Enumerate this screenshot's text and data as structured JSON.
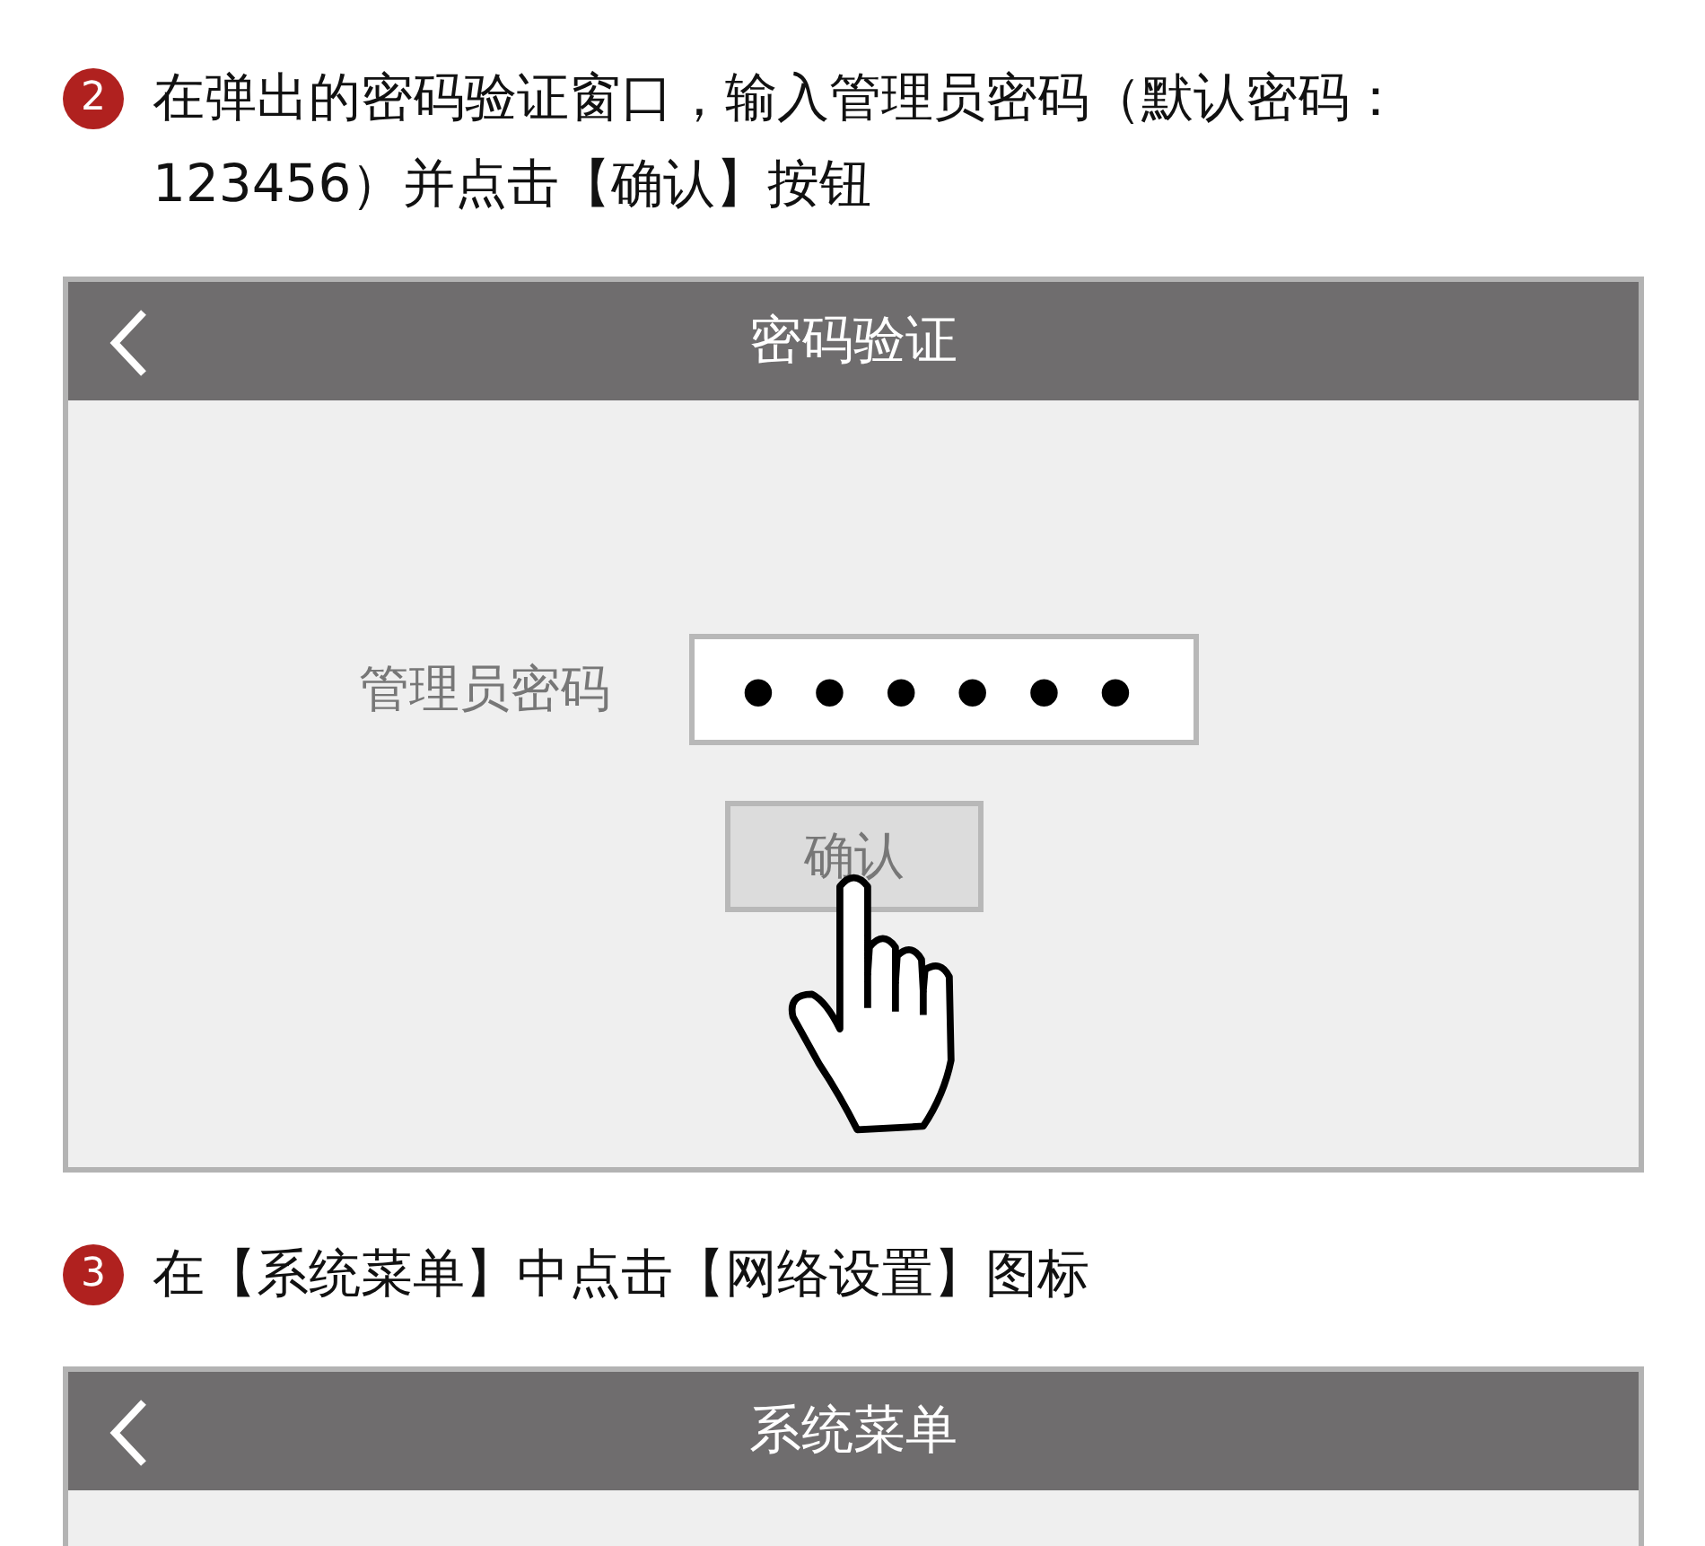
{
  "steps": [
    {
      "number": "2",
      "text": "在弹出的密码验证窗口，输入管理员密码（默认密码：123456）并点击【确认】按钮",
      "screen": {
        "title": "密码验证",
        "field_label": "管理员密码",
        "password": "● ● ● ● ● ●",
        "button": "确认"
      }
    },
    {
      "number": "3",
      "text": "在【系统菜单】中点击【网络设置】图标",
      "screen": {
        "title": "系统菜单"
      }
    }
  ]
}
